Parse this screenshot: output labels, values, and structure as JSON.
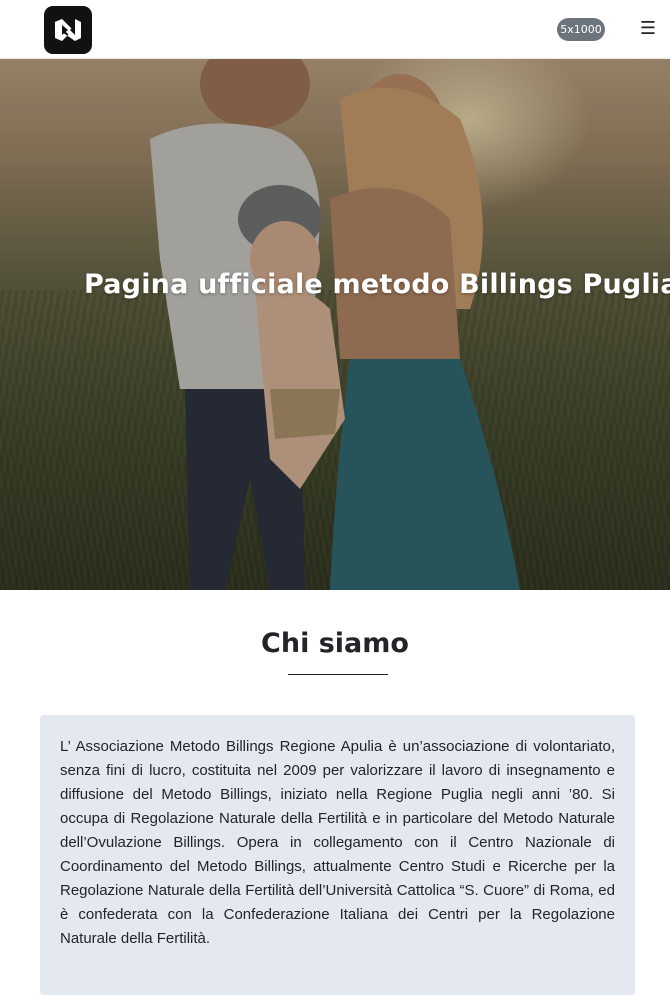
{
  "header": {
    "logo_icon": "vs-code-style-logo-icon",
    "badge_label": "5x1000",
    "menu_icon": "hamburger-menu-icon",
    "menu_glyph": "☰"
  },
  "hero": {
    "title": "Pagina ufficiale metodo Billings Puglia"
  },
  "about": {
    "heading": "Chi siamo",
    "body": "L’ Associazione Metodo Billings Regione Apulia è un’associazione di volontariato, senza fini di lucro, costituita nel 2009 per valorizzare il lavoro di insegnamento e diffusione del Metodo Billings, iniziato nella Regione Puglia negli anni ’80. Si occupa di Regolazione Naturale della Fertilità e in particolare del Metodo Naturale dell’Ovulazione Billings. Opera in collegamento con il Centro Nazionale di Coordinamento del Metodo Billings, attualmente Centro Studi e Ricerche per la Regolazione Naturale della Fertilità dell’Università Cattolica “S. Cuore” di Roma, ed è confederata con la Confederazione Italiana dei Centri per la Regolazione Naturale della Fertilità."
  },
  "colors": {
    "badge": "#6c757d",
    "card_background": "#e4e9f1",
    "text": "#212529"
  }
}
